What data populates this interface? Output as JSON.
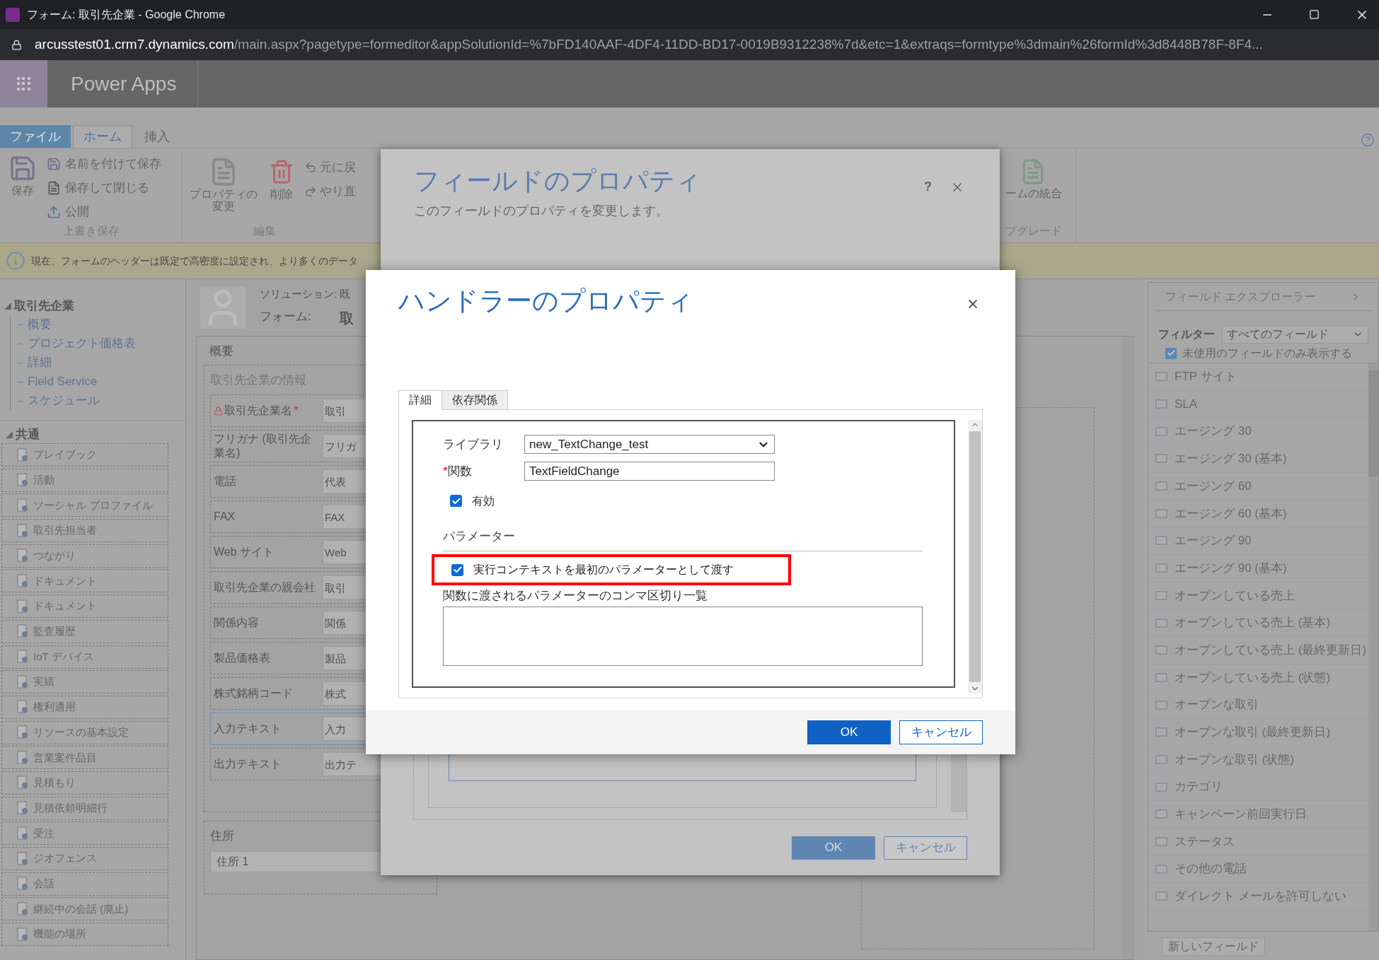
{
  "browser": {
    "title": "フォーム: 取引先企業 - Google Chrome",
    "url_host": "arcusstest01.crm7.dynamics.com",
    "url_path": "/main.aspx?pagetype=formeditor&appSolutionId=%7bFD140AAF-4DF4-11DD-BD17-0019B9312238%7d&etc=1&extraqs=formtype%3dmain%26formId%3d8448B78F-8F4..."
  },
  "app": {
    "name": "Power Apps"
  },
  "ribbon": {
    "tabs": [
      {
        "label": "ファイル",
        "selected": false,
        "kind": "file"
      },
      {
        "label": "ホーム",
        "selected": true,
        "kind": "tab"
      },
      {
        "label": "挿入",
        "selected": false,
        "kind": "tab"
      }
    ],
    "save_group": {
      "big": "保存",
      "items": [
        "名前を付けて保存",
        "保存して閉じる",
        "公開"
      ],
      "label": "上書き保存"
    },
    "edit_group": {
      "big": [
        "プロパティの変更",
        "削除"
      ],
      "items": [
        "元に戻",
        "やり直"
      ],
      "label": "編集"
    },
    "upgrade_group": {
      "item": "ームの統合",
      "label": "プグレード"
    }
  },
  "info_bar": {
    "text": "現在、フォームのヘッダーは既定で高密度に設定され、より多くのデータ"
  },
  "sidebar": {
    "tree": {
      "label": "取引先企業",
      "expanded": true,
      "children": [
        "概要",
        "プロジェクト価格表",
        "詳細",
        "Field Service",
        "スケジュール"
      ]
    },
    "common": {
      "label": "共通",
      "items": [
        "プレイブック",
        "活動",
        "ソーシャル プロファイル",
        "取引先担当者",
        "つながり",
        "ドキュメント",
        "ドキュメント",
        "監査履歴",
        "IoT デバイス",
        "実績",
        "権利適用",
        "リソースの基本設定",
        "営業案件品目",
        "見積もり",
        "見積依頼明細行",
        "受注",
        "ジオフェンス",
        "会話",
        "継続中の会話 (廃止)",
        "機能の場所"
      ]
    }
  },
  "form": {
    "solution_label": "ソリューション: 既",
    "form_label": "フォーム:",
    "form_name": "取",
    "tab": "概要",
    "section": "取引先企業の情報",
    "fields": [
      {
        "label": "取引先企業名",
        "required_mark": "*",
        "locked": true,
        "placeholder": "取引",
        "selected": false
      },
      {
        "label": "フリガナ (取引先企業名)",
        "locked": false,
        "placeholder": "フリガ",
        "selected": false
      },
      {
        "label": "電話",
        "locked": false,
        "placeholder": "代表",
        "selected": false
      },
      {
        "label": "FAX",
        "locked": false,
        "placeholder": "FAX",
        "selected": false
      },
      {
        "label": "Web サイト",
        "locked": false,
        "placeholder": "Web",
        "selected": false
      },
      {
        "label": "取引先企業の親会社",
        "locked": false,
        "placeholder": "取引",
        "selected": false
      },
      {
        "label": "関係内容",
        "locked": false,
        "placeholder": "関係",
        "selected": false
      },
      {
        "label": "製品価格表",
        "locked": false,
        "placeholder": "製品",
        "selected": false
      },
      {
        "label": "株式銘柄コード",
        "locked": false,
        "placeholder": "株式",
        "selected": false
      },
      {
        "label": "入力テキスト",
        "locked": false,
        "placeholder": "入力",
        "selected": true
      },
      {
        "label": "出力テキスト",
        "locked": false,
        "placeholder": "出力テ",
        "selected": false
      }
    ],
    "address_section": "住所",
    "address_placeholder": "住所 1"
  },
  "field_explorer": {
    "title": "フィールド エクスプローラー",
    "filter_label": "フィルター",
    "filter_value": "すべてのフィールド",
    "unused_only": {
      "label": "未使用のフィールドのみ表示する",
      "checked": true
    },
    "fields": [
      "FTP サイト",
      "SLA",
      "エージング 30",
      "エージング 30 (基本)",
      "エージング 60",
      "エージング 60 (基本)",
      "エージング 90",
      "エージング 90 (基本)",
      "オープンしている売上",
      "オープンしている売上 (基本)",
      "オープンしている売上 (最終更新日)",
      "オープンしている売上 (状態)",
      "オープンな取引",
      "オープンな取引 (最終更新日)",
      "オープンな取引 (状態)",
      "カテゴリ",
      "キャンペーン前回実行日",
      "ステータス",
      "その他の電話",
      "ダイレクト メールを許可しない"
    ],
    "new_field_button": "新しいフィールド"
  },
  "field_dialog": {
    "title": "フィールドのプロパティ",
    "subtitle": "このフィールドのプロパティを変更します。",
    "help": "?",
    "buttons": [
      "OK",
      "キャンセル"
    ]
  },
  "handler_dialog": {
    "title": "ハンドラーのプロパティ",
    "tabs": [
      {
        "label": "詳細",
        "selected": true
      },
      {
        "label": "依存関係",
        "selected": false
      }
    ],
    "library_label": "ライブラリ",
    "library_value": "new_TextChange_test",
    "function_label": "関数",
    "function_required_mark": "*",
    "function_value": "TextFieldChange",
    "enabled": {
      "label": "有効",
      "checked": true
    },
    "parameters_heading": "パラメーター",
    "pass_context": {
      "label": "実行コンテキストを最初のパラメーターとして渡す",
      "checked": true,
      "highlighted": true
    },
    "params_label": "関数に渡されるパラメーターのコンマ区切り一覧",
    "buttons": [
      "OK",
      "キャンセル"
    ]
  }
}
